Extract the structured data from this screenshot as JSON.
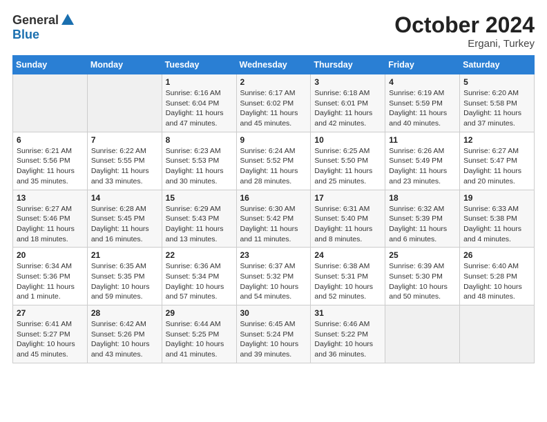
{
  "logo": {
    "general": "General",
    "blue": "Blue"
  },
  "title": "October 2024",
  "location": "Ergani, Turkey",
  "days_of_week": [
    "Sunday",
    "Monday",
    "Tuesday",
    "Wednesday",
    "Thursday",
    "Friday",
    "Saturday"
  ],
  "weeks": [
    [
      {
        "day": "",
        "info": ""
      },
      {
        "day": "",
        "info": ""
      },
      {
        "day": "1",
        "info": "Sunrise: 6:16 AM\nSunset: 6:04 PM\nDaylight: 11 hours and 47 minutes."
      },
      {
        "day": "2",
        "info": "Sunrise: 6:17 AM\nSunset: 6:02 PM\nDaylight: 11 hours and 45 minutes."
      },
      {
        "day": "3",
        "info": "Sunrise: 6:18 AM\nSunset: 6:01 PM\nDaylight: 11 hours and 42 minutes."
      },
      {
        "day": "4",
        "info": "Sunrise: 6:19 AM\nSunset: 5:59 PM\nDaylight: 11 hours and 40 minutes."
      },
      {
        "day": "5",
        "info": "Sunrise: 6:20 AM\nSunset: 5:58 PM\nDaylight: 11 hours and 37 minutes."
      }
    ],
    [
      {
        "day": "6",
        "info": "Sunrise: 6:21 AM\nSunset: 5:56 PM\nDaylight: 11 hours and 35 minutes."
      },
      {
        "day": "7",
        "info": "Sunrise: 6:22 AM\nSunset: 5:55 PM\nDaylight: 11 hours and 33 minutes."
      },
      {
        "day": "8",
        "info": "Sunrise: 6:23 AM\nSunset: 5:53 PM\nDaylight: 11 hours and 30 minutes."
      },
      {
        "day": "9",
        "info": "Sunrise: 6:24 AM\nSunset: 5:52 PM\nDaylight: 11 hours and 28 minutes."
      },
      {
        "day": "10",
        "info": "Sunrise: 6:25 AM\nSunset: 5:50 PM\nDaylight: 11 hours and 25 minutes."
      },
      {
        "day": "11",
        "info": "Sunrise: 6:26 AM\nSunset: 5:49 PM\nDaylight: 11 hours and 23 minutes."
      },
      {
        "day": "12",
        "info": "Sunrise: 6:27 AM\nSunset: 5:47 PM\nDaylight: 11 hours and 20 minutes."
      }
    ],
    [
      {
        "day": "13",
        "info": "Sunrise: 6:27 AM\nSunset: 5:46 PM\nDaylight: 11 hours and 18 minutes."
      },
      {
        "day": "14",
        "info": "Sunrise: 6:28 AM\nSunset: 5:45 PM\nDaylight: 11 hours and 16 minutes."
      },
      {
        "day": "15",
        "info": "Sunrise: 6:29 AM\nSunset: 5:43 PM\nDaylight: 11 hours and 13 minutes."
      },
      {
        "day": "16",
        "info": "Sunrise: 6:30 AM\nSunset: 5:42 PM\nDaylight: 11 hours and 11 minutes."
      },
      {
        "day": "17",
        "info": "Sunrise: 6:31 AM\nSunset: 5:40 PM\nDaylight: 11 hours and 8 minutes."
      },
      {
        "day": "18",
        "info": "Sunrise: 6:32 AM\nSunset: 5:39 PM\nDaylight: 11 hours and 6 minutes."
      },
      {
        "day": "19",
        "info": "Sunrise: 6:33 AM\nSunset: 5:38 PM\nDaylight: 11 hours and 4 minutes."
      }
    ],
    [
      {
        "day": "20",
        "info": "Sunrise: 6:34 AM\nSunset: 5:36 PM\nDaylight: 11 hours and 1 minute."
      },
      {
        "day": "21",
        "info": "Sunrise: 6:35 AM\nSunset: 5:35 PM\nDaylight: 10 hours and 59 minutes."
      },
      {
        "day": "22",
        "info": "Sunrise: 6:36 AM\nSunset: 5:34 PM\nDaylight: 10 hours and 57 minutes."
      },
      {
        "day": "23",
        "info": "Sunrise: 6:37 AM\nSunset: 5:32 PM\nDaylight: 10 hours and 54 minutes."
      },
      {
        "day": "24",
        "info": "Sunrise: 6:38 AM\nSunset: 5:31 PM\nDaylight: 10 hours and 52 minutes."
      },
      {
        "day": "25",
        "info": "Sunrise: 6:39 AM\nSunset: 5:30 PM\nDaylight: 10 hours and 50 minutes."
      },
      {
        "day": "26",
        "info": "Sunrise: 6:40 AM\nSunset: 5:28 PM\nDaylight: 10 hours and 48 minutes."
      }
    ],
    [
      {
        "day": "27",
        "info": "Sunrise: 6:41 AM\nSunset: 5:27 PM\nDaylight: 10 hours and 45 minutes."
      },
      {
        "day": "28",
        "info": "Sunrise: 6:42 AM\nSunset: 5:26 PM\nDaylight: 10 hours and 43 minutes."
      },
      {
        "day": "29",
        "info": "Sunrise: 6:44 AM\nSunset: 5:25 PM\nDaylight: 10 hours and 41 minutes."
      },
      {
        "day": "30",
        "info": "Sunrise: 6:45 AM\nSunset: 5:24 PM\nDaylight: 10 hours and 39 minutes."
      },
      {
        "day": "31",
        "info": "Sunrise: 6:46 AM\nSunset: 5:22 PM\nDaylight: 10 hours and 36 minutes."
      },
      {
        "day": "",
        "info": ""
      },
      {
        "day": "",
        "info": ""
      }
    ]
  ]
}
